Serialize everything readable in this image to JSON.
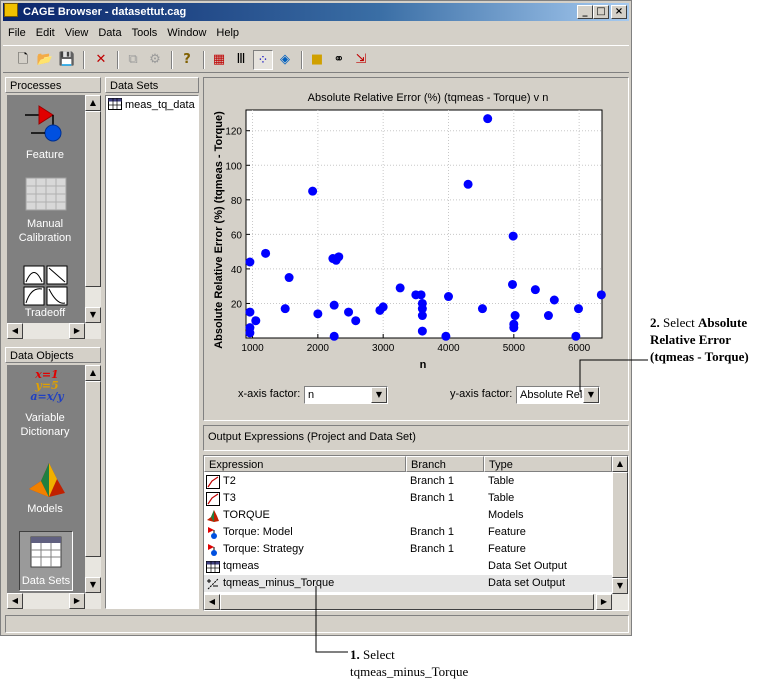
{
  "window": {
    "title": "CAGE Browser - datasettut.cag",
    "minimize": "_",
    "maximize": "□",
    "close": "×"
  },
  "menu": [
    "File",
    "Edit",
    "View",
    "Data",
    "Tools",
    "Window",
    "Help"
  ],
  "toolbar": {
    "icons": [
      "new-file-icon",
      "open-folder-icon",
      "save-icon",
      "delete-icon",
      "copy-icon",
      "paste-icon",
      "help-icon",
      "table-view-icon",
      "column-view-icon",
      "plot-view-icon",
      "surface-view-icon",
      "color-map-icon",
      "link-icon",
      "export-icon"
    ]
  },
  "processes": {
    "header": "Processes",
    "items": [
      {
        "label": "Feature",
        "icon": "feature-icon"
      },
      {
        "label": "Manual Calibration",
        "icon": "manual-calibration-icon"
      },
      {
        "label": "Tradeoff",
        "icon": "tradeoff-icon"
      }
    ]
  },
  "data_objects": {
    "header": "Data Objects",
    "items": [
      {
        "label": "Variable Dictionary",
        "icon": "variable-dictionary-icon",
        "glyph": "x=1 y=5 a=x/y"
      },
      {
        "label": "Models",
        "icon": "models-icon"
      },
      {
        "label": "Data Sets",
        "icon": "data-sets-icon"
      }
    ]
  },
  "datasets": {
    "header": "Data Sets",
    "items": [
      {
        "label": "meas_tq_data",
        "icon": "table-icon"
      }
    ]
  },
  "chart_data": {
    "type": "scatter",
    "title": "Absolute Relative Error (%) (tqmeas - Torque) v n",
    "xlabel": "n",
    "ylabel": "Absolute Relative Error (%) (tqmeas - Torque)",
    "xlim": [
      900,
      6350
    ],
    "ylim": [
      0,
      132
    ],
    "xticks": [
      1000,
      2000,
      3000,
      4000,
      5000,
      6000
    ],
    "yticks": [
      20,
      40,
      60,
      80,
      100,
      120
    ],
    "grid": true,
    "color": "#0000ff",
    "points": [
      [
        960,
        44
      ],
      [
        960,
        15
      ],
      [
        960,
        6
      ],
      [
        960,
        3
      ],
      [
        1050,
        10
      ],
      [
        1200,
        49
      ],
      [
        1500,
        17
      ],
      [
        1560,
        35
      ],
      [
        1920,
        85
      ],
      [
        2000,
        14
      ],
      [
        2230,
        46
      ],
      [
        2250,
        19
      ],
      [
        2250,
        1
      ],
      [
        2280,
        45
      ],
      [
        2320,
        47
      ],
      [
        2470,
        15
      ],
      [
        2580,
        10
      ],
      [
        2950,
        16
      ],
      [
        3000,
        18
      ],
      [
        3260,
        29
      ],
      [
        3500,
        25
      ],
      [
        3580,
        25
      ],
      [
        3600,
        20
      ],
      [
        3600,
        17
      ],
      [
        3600,
        13
      ],
      [
        3600,
        4
      ],
      [
        3960,
        1
      ],
      [
        4000,
        24
      ],
      [
        4300,
        89
      ],
      [
        4520,
        17
      ],
      [
        4600,
        127
      ],
      [
        4980,
        31
      ],
      [
        4990,
        59
      ],
      [
        5000,
        8
      ],
      [
        5000,
        6
      ],
      [
        5020,
        13
      ],
      [
        5330,
        28
      ],
      [
        5530,
        13
      ],
      [
        5620,
        22
      ],
      [
        5950,
        1
      ],
      [
        5990,
        17
      ],
      [
        6340,
        25
      ]
    ]
  },
  "axis_factors": {
    "x_label": "x-axis factor:",
    "x_value": "n",
    "y_label": "y-axis factor:",
    "y_value": "Absolute Rela"
  },
  "output_expressions": {
    "header": "Output Expressions (Project and Data Set)",
    "columns": [
      "Expression",
      "Branch",
      "Type"
    ],
    "rows": [
      {
        "icon": "table-icon",
        "name": "T2",
        "branch": "Branch 1",
        "type": "Table"
      },
      {
        "icon": "table-icon",
        "name": "T3",
        "branch": "Branch 1",
        "type": "Table"
      },
      {
        "icon": "model-icon",
        "name": "TORQUE",
        "branch": "",
        "type": "Models"
      },
      {
        "icon": "feature-icon",
        "name": "Torque: Model",
        "branch": "Branch 1",
        "type": "Feature"
      },
      {
        "icon": "feature-icon",
        "name": "Torque: Strategy",
        "branch": "Branch 1",
        "type": "Feature"
      },
      {
        "icon": "dataset-icon",
        "name": "tqmeas",
        "branch": "",
        "type": "Data Set Output"
      },
      {
        "icon": "expression-icon",
        "name": "tqmeas_minus_Torque",
        "branch": "",
        "type": "Data set Output"
      }
    ]
  },
  "annotations": {
    "a2": {
      "num": "2.",
      "lead": "Select",
      "b1": "Absolute",
      "b2": "Relative Error",
      "b3": "(tqmeas - Torque)"
    },
    "a1": {
      "num": "1.",
      "lead": "Select",
      "l2": "tqmeas_minus_Torque"
    }
  }
}
